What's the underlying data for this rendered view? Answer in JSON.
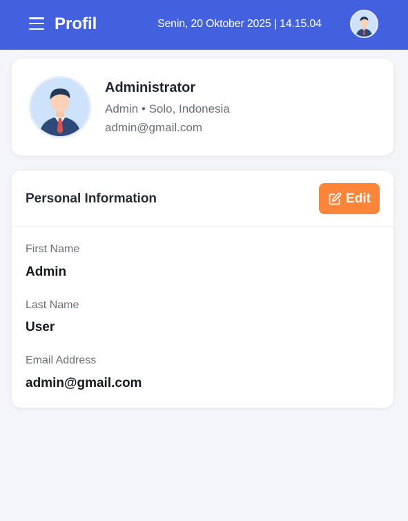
{
  "header": {
    "title": "Profil",
    "datetime": "Senin, 20 Oktober 2025 | 14.15.04",
    "accent": "#4361de"
  },
  "profile": {
    "name": "Administrator",
    "subtitle": "Admin • Solo, Indonesia",
    "email": "admin@gmail.com"
  },
  "personal_info": {
    "title": "Personal Information",
    "edit_label": "Edit",
    "edit_color": "#fd853a",
    "fields": [
      {
        "label": "First Name",
        "value": "Admin"
      },
      {
        "label": "Last Name",
        "value": "User"
      },
      {
        "label": "Email Address",
        "value": "admin@gmail.com"
      }
    ]
  },
  "icons": {
    "menu": "hamburger-menu-icon",
    "avatar": "user-avatar-icon",
    "edit": "edit-pencil-icon"
  }
}
